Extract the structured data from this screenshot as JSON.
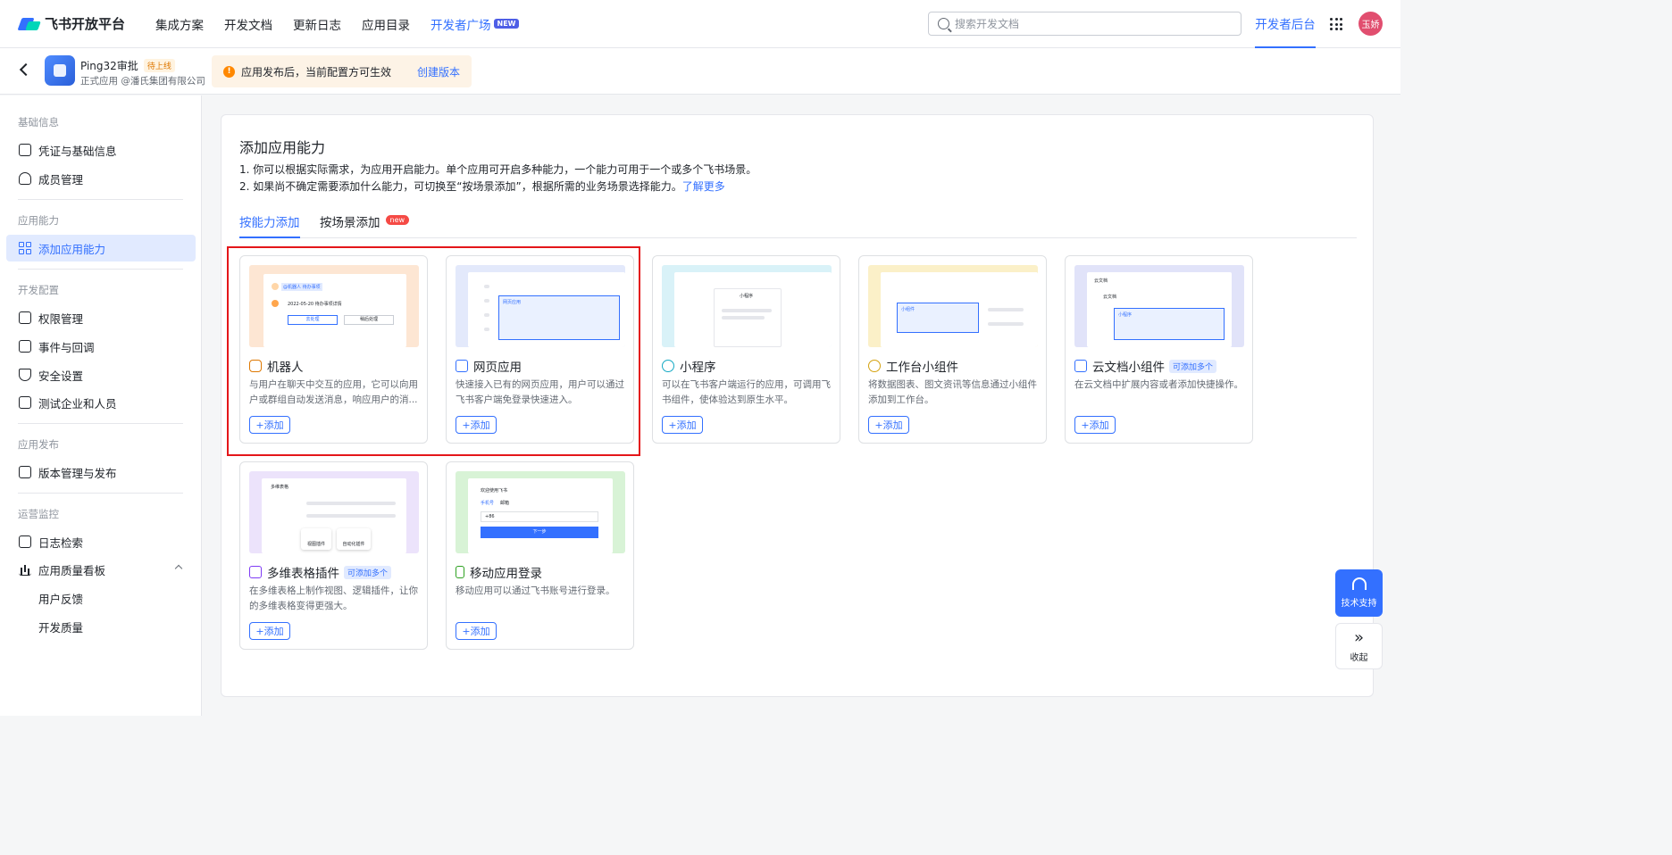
{
  "topnav": {
    "logo": "飞书开放平台",
    "links": [
      "集成方案",
      "开发文档",
      "更新日志",
      "应用目录"
    ],
    "highlight_link": "开发者广场",
    "highlight_badge": "NEW",
    "search_placeholder": "搜索开发文档",
    "dev_console": "开发者后台",
    "avatar": "玉娇"
  },
  "appbar": {
    "app_name": "Ping32审批",
    "app_status": "待上线",
    "app_sub": "正式应用 @潘氏集团有限公司",
    "notice": "应用发布后，当前配置方可生效",
    "notice_link": "创建版本"
  },
  "sidebar": {
    "groups": [
      "基础信息",
      "应用能力",
      "开发配置",
      "应用发布",
      "运营监控"
    ],
    "items": [
      "凭证与基础信息",
      "成员管理",
      "添加应用能力",
      "权限管理",
      "事件与回调",
      "安全设置",
      "测试企业和人员",
      "版本管理与发布",
      "日志检索",
      "应用质量看板",
      "用户反馈",
      "开发质量"
    ]
  },
  "main": {
    "title": "添加应用能力",
    "desc1": "1. 你可以根据实际需求，为应用开启能力。单个应用可开启多种能力，一个能力可用于一个或多个飞书场景。",
    "desc2": "2. 如果尚不确定需要添加什么能力，可切换至“按场景添加”，根据所需的业务场景选择能力。",
    "desc2_link": "了解更多",
    "tabs": [
      "按能力添加",
      "按场景添加"
    ],
    "tab_badge": "new",
    "add_label": "添加",
    "multi_badge": "可添加多个",
    "cards": [
      {
        "title": "机器人",
        "desc": "与用户在聊天中交互的应用，它可以向用户或群组自动发送消息，响应用户的消...",
        "mock": [
          "@机器人 待办事项",
          "2022-05-20 待办事项详情",
          "去处理",
          "稍后处理"
        ]
      },
      {
        "title": "网页应用",
        "desc": "快速接入已有的网页应用，用户可以通过飞书客户端免登录快速进入。",
        "mock": [
          "网页应用"
        ]
      },
      {
        "title": "小程序",
        "desc": "可以在飞书客户端运行的应用，可调用飞书组件，使体验达到原生水平。",
        "mock": [
          "小程序"
        ]
      },
      {
        "title": "工作台小组件",
        "desc": "将数据图表、图文资讯等信息通过小组件添加到工作台。",
        "mock": [
          "小组件"
        ]
      },
      {
        "title": "云文档小组件",
        "desc": "在云文档中扩展内容或者添加快捷操作。",
        "mock": [
          "云文档",
          "云文档",
          "小程序"
        ]
      },
      {
        "title": "多维表格插件",
        "desc": "在多维表格上制作视图、逻辑插件，让你的多维表格变得更强大。",
        "mock": [
          "多维表格",
          "视图插件",
          "自动化插件"
        ]
      },
      {
        "title": "移动应用登录",
        "desc": "移动应用可以通过飞书账号进行登录。",
        "mock": [
          "欢迎使用飞书",
          "手机号",
          "邮箱",
          "+86",
          "下一步"
        ]
      }
    ]
  },
  "floating": {
    "support": "技术支持",
    "collapse": "收起"
  }
}
